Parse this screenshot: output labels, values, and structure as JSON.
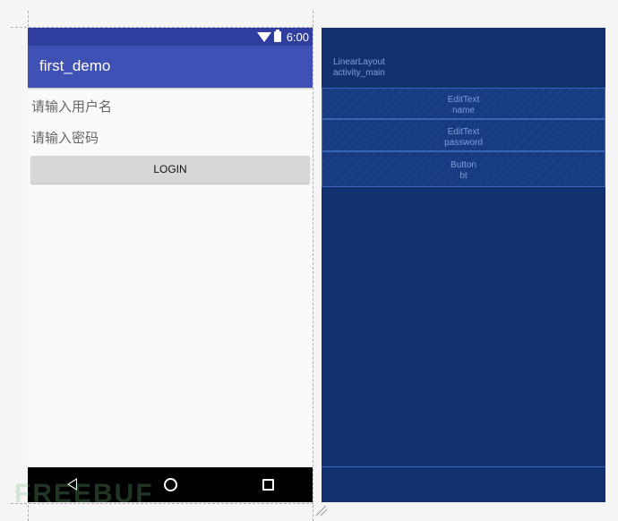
{
  "phone": {
    "status_bar": {
      "time": "6:00",
      "wifi_icon": "wifi-icon",
      "battery_icon": "battery-icon"
    },
    "app_bar": {
      "title": "first_demo"
    },
    "name_field": {
      "hint": "请输入用户名"
    },
    "password_field": {
      "hint": "请输入密码"
    },
    "login_button": {
      "label": "LOGIN"
    },
    "nav_bar": {
      "back_icon": "back-icon",
      "home_icon": "home-icon",
      "recents_icon": "recents-icon"
    }
  },
  "blueprint": {
    "root": {
      "type": "LinearLayout",
      "id": "activity_main"
    },
    "views": [
      {
        "type": "EditText",
        "id": "name"
      },
      {
        "type": "EditText",
        "id": "password"
      },
      {
        "type": "Button",
        "id": "bt"
      }
    ]
  },
  "watermark": {
    "text": "FREEBUF"
  },
  "colors": {
    "status_bar": "#303f9f",
    "app_bar": "#3f51b5",
    "button": "#d6d7d7",
    "blueprint_bg": "#12316e",
    "blueprint_text": "#7f9fd8"
  }
}
